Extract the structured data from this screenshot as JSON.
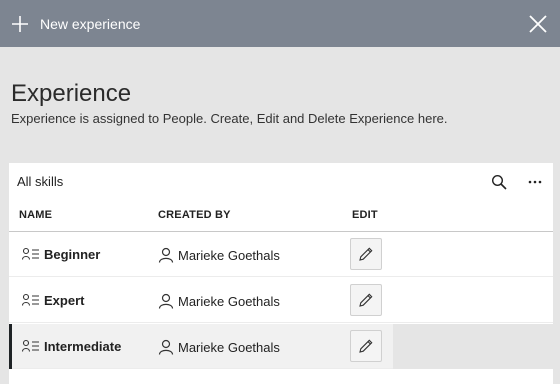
{
  "topbar": {
    "new_label": "New experience",
    "icons": {
      "add": "plus-icon",
      "close": "close-icon"
    },
    "color": "#7d8591"
  },
  "page": {
    "title": "Experience",
    "description": "Experience is assigned to People. Create, Edit and Delete Experience here."
  },
  "list": {
    "title": "All skills",
    "icons": {
      "search": "search-icon",
      "more": "more-icon"
    },
    "columns": {
      "name": "NAME",
      "created_by": "CREATED BY",
      "edit": "EDIT"
    },
    "rows": [
      {
        "name": "Beginner",
        "created_by": "Marieke Goethals",
        "selected": false
      },
      {
        "name": "Expert",
        "created_by": "Marieke Goethals",
        "selected": false
      },
      {
        "name": "Intermediate",
        "created_by": "Marieke Goethals",
        "selected": true
      }
    ]
  }
}
